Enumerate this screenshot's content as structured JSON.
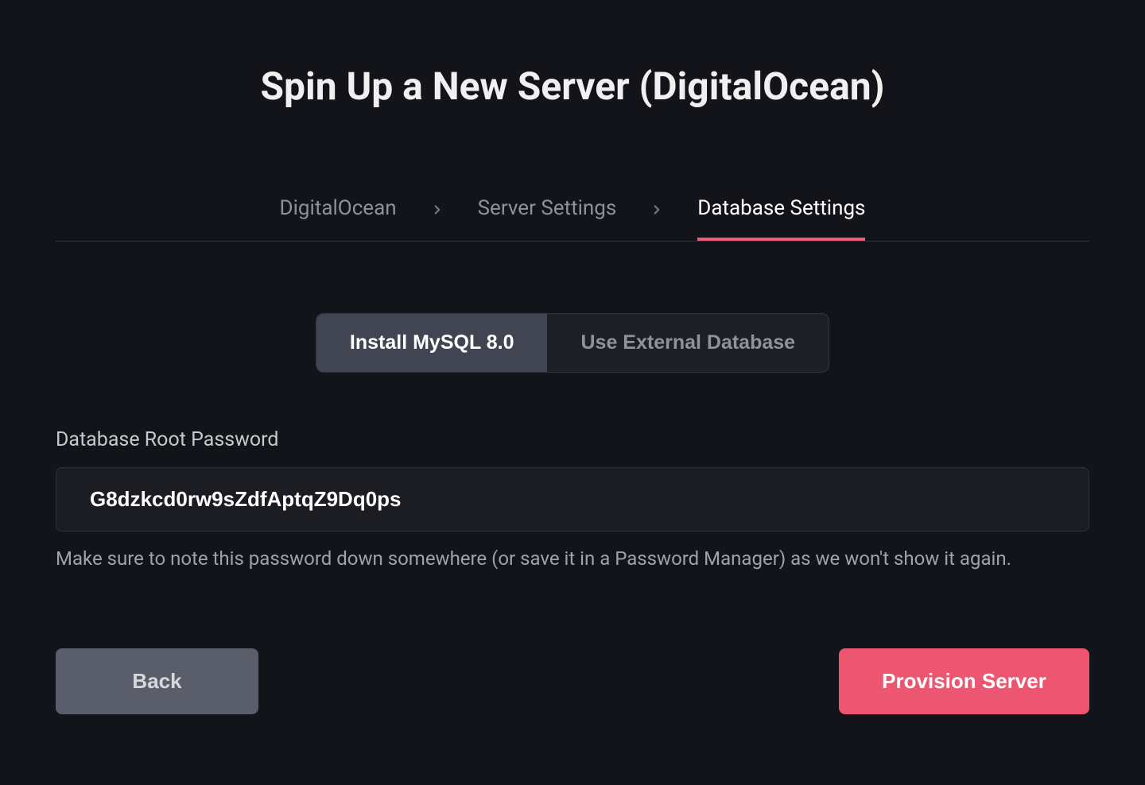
{
  "header": {
    "title": "Spin Up a New Server (DigitalOcean)"
  },
  "breadcrumb": {
    "items": [
      {
        "label": "DigitalOcean",
        "active": false
      },
      {
        "label": "Server Settings",
        "active": false
      },
      {
        "label": "Database Settings",
        "active": true
      }
    ]
  },
  "segments": {
    "options": [
      {
        "label": "Install MySQL 8.0",
        "active": true
      },
      {
        "label": "Use External Database",
        "active": false
      }
    ]
  },
  "form": {
    "password_label": "Database Root Password",
    "password_value": "G8dzkcd0rw9sZdfAptqZ9Dq0ps",
    "password_hint": "Make sure to note this password down somewhere (or save it in a Password Manager) as we won't show it again."
  },
  "buttons": {
    "back": "Back",
    "submit": "Provision Server"
  },
  "colors": {
    "accent": "#ed5671",
    "background": "#121419",
    "input_bg": "#1b1d23",
    "segment_bg": "#1d1f26",
    "segment_active": "#414451",
    "back_btn": "#5a5e6a"
  }
}
